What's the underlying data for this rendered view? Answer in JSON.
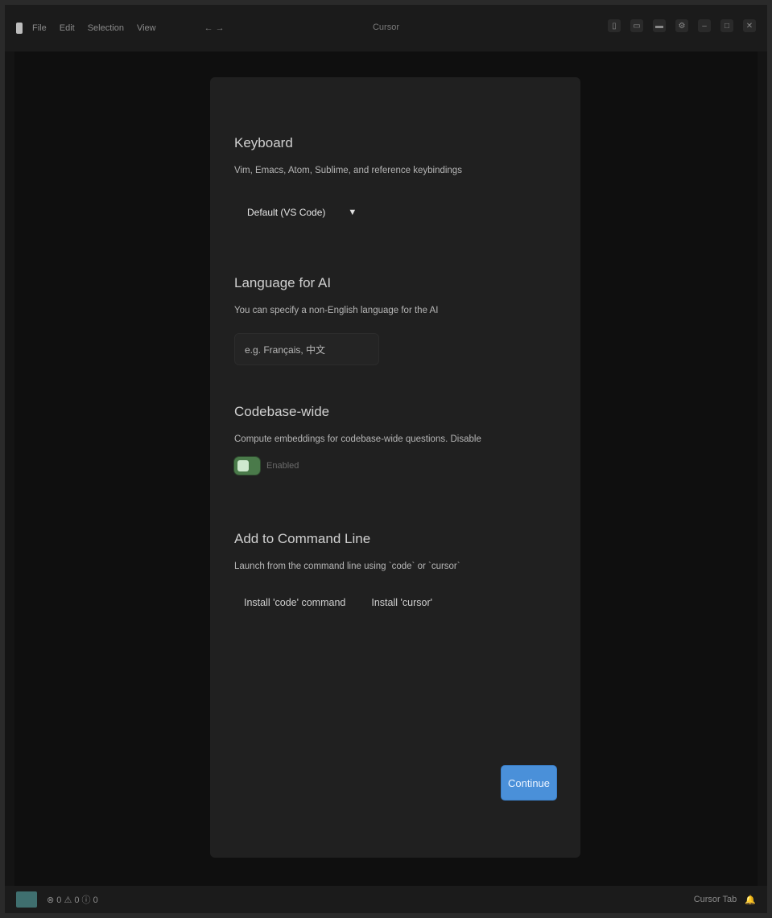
{
  "topbar": {
    "menu": [
      "File",
      "Edit",
      "Selection",
      "View"
    ],
    "title": "Cursor",
    "nav": "← →"
  },
  "settings": {
    "keyboard": {
      "title": "Keyboard",
      "description": "Vim, Emacs, Atom, Sublime, and reference keybindings",
      "select_value": "Default (VS Code)"
    },
    "language": {
      "title": "Language for AI",
      "description": "You can specify a non-English language for the AI",
      "input_placeholder": "e.g. Français, 中文"
    },
    "codebase": {
      "title": "Codebase-wide",
      "description": "Compute embeddings for codebase-wide questions. Disable",
      "toggle_label": "Enabled",
      "enabled": true
    },
    "command_line": {
      "title": "Add to Command Line",
      "description": "Launch from the command line using `code` or `cursor`",
      "btn_code": "Install 'code' command",
      "btn_cursor": "Install 'cursor'"
    },
    "continue_label": "Continue"
  },
  "statusbar": {
    "left_text": "⊗ 0 ⚠ 0   ⓘ 0",
    "right_text": "Cursor Tab"
  }
}
